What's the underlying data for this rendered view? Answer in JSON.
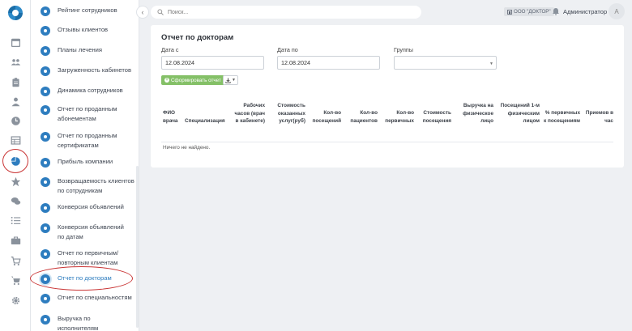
{
  "sidebar_submenu": {
    "items": [
      {
        "label": "Рейтинг сотрудников",
        "active": false
      },
      {
        "label": "Отзывы клиентов",
        "active": false
      },
      {
        "label": "Планы лечения",
        "active": false
      },
      {
        "label": "Загруженность кабинетов",
        "active": false
      },
      {
        "label": "Динамика сотрудников",
        "active": false
      },
      {
        "label": "Отчет по проданным абонементам",
        "active": false
      },
      {
        "label": "Отчет по проданным сертификатам",
        "active": false
      },
      {
        "label": "Прибыль компании",
        "active": false
      },
      {
        "label": "Возвращаемость клиентов по сотрудникам",
        "active": false
      },
      {
        "label": "Конверсия объявлений",
        "active": false
      },
      {
        "label": "Конверсия объявлений по датам",
        "active": false
      },
      {
        "label": "Отчет по первичным/ повторным клиентам",
        "active": false
      },
      {
        "label": "Отчет по докторам",
        "active": true
      },
      {
        "label": "Отчет по специальностям",
        "active": false
      },
      {
        "label": "Выручка по исполнителям",
        "active": false
      }
    ]
  },
  "rail_icons": [
    "calendar-icon",
    "users-icon",
    "clipboard-icon",
    "person-icon",
    "clock-icon",
    "table-icon",
    "reports-pie-icon",
    "star-icon",
    "chat-icon",
    "list-icon",
    "briefcase-icon",
    "cart-icon",
    "cart-plus-icon",
    "gear-icon"
  ],
  "topbar": {
    "search_placeholder": "Поиск...",
    "org_badge": "ООО \"ДОКТОР\"",
    "user_name": "Администратор",
    "avatar_letter": "А"
  },
  "report": {
    "title": "Отчет по докторам",
    "date_from_label": "Дата с",
    "date_from_value": "12.08.2024",
    "date_to_label": "Дата по",
    "date_to_value": "12.08.2024",
    "groups_label": "Группы",
    "generate_button": "Сформировать отчет",
    "columns": [
      "ФИО врача",
      "Специализация",
      "Рабочих часов (врач в кабинете)",
      "Стоимость оказанных услуг(руб)",
      "Кол-во посещений",
      "Кол-во пациентов",
      "Кол-во первичных",
      "Стоимость посещения",
      "Выручка на физическое лицо",
      "Посещений 1-м физическим лицом",
      "% первичных к посещениям",
      "Приемов в час"
    ],
    "empty_text": "Ничего не найдено."
  },
  "colors": {
    "accent": "#2e7dbf",
    "success": "#84c067",
    "highlight_circle": "#c93434",
    "background": "#eef0f3"
  }
}
